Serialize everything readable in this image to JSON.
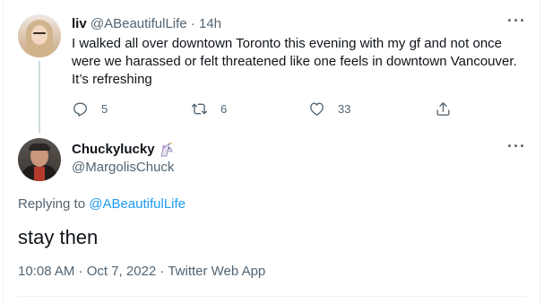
{
  "parent_tweet": {
    "name": "liv",
    "handle": "@ABeautifulLife",
    "separator": "·",
    "time": "14h",
    "text": "I walked all over downtown Toronto this evening with my gf and not once were we harassed or felt threatened like one feels in downtown Vancouver. It’s refreshing",
    "actions": {
      "reply_count": "5",
      "retweet_count": "6",
      "like_count": "33"
    },
    "avatar_icon": "profile-photo"
  },
  "focused_tweet": {
    "name": "Chuckylucky",
    "name_emoji": "unicorn-icon",
    "handle": "@MargolisChuck",
    "replying_prefix": "Replying to",
    "replying_to": "@ABeautifulLife",
    "text": "stay then",
    "timestamp": "10:08 AM · Oct 7, 2022 · Twitter Web App"
  },
  "colors": {
    "text_primary": "#0f1419",
    "text_secondary": "#536471",
    "link": "#1d9bf0",
    "thread_line": "#cfd9de",
    "divider": "#eff3f4"
  }
}
